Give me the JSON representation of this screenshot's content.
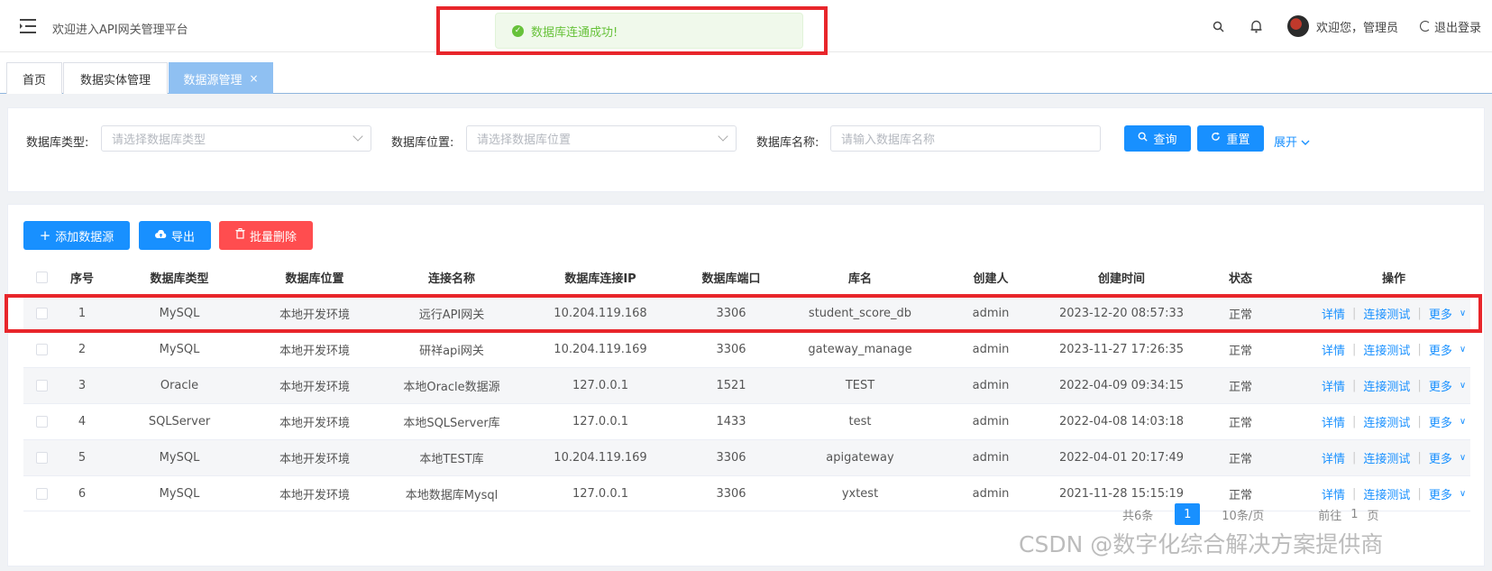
{
  "header": {
    "welcome": "欢迎进入API网关管理平台",
    "toast": "数据库连通成功!",
    "user_text": "欢迎您，管理员",
    "logout": "退出登录"
  },
  "tabs": [
    {
      "label": "首页"
    },
    {
      "label": "数据实体管理"
    },
    {
      "label": "数据源管理",
      "close": "×"
    }
  ],
  "filters": {
    "db_type_label": "数据库类型:",
    "db_type_placeholder": "请选择数据库类型",
    "db_location_label": "数据库位置:",
    "db_location_placeholder": "请选择数据库位置",
    "db_name_label": "数据库名称:",
    "db_name_placeholder": "请输入数据库名称",
    "query": "查询",
    "reset": "重置",
    "expand": "展开"
  },
  "toolbar": {
    "add": "添加数据源",
    "export": "导出",
    "batch_delete": "批量删除"
  },
  "table": {
    "headers": [
      "序号",
      "数据库类型",
      "数据库位置",
      "连接名称",
      "数据库连接IP",
      "数据库端口",
      "库名",
      "创建人",
      "创建时间",
      "状态",
      "操作"
    ],
    "rows": [
      [
        "1",
        "MySQL",
        "本地开发环境",
        "远行API网关",
        "10.204.119.168",
        "3306",
        "student_score_db",
        "admin",
        "2023-12-20 08:57:33",
        "正常"
      ],
      [
        "2",
        "MySQL",
        "本地开发环境",
        "研祥api网关",
        "10.204.119.169",
        "3306",
        "gateway_manage",
        "admin",
        "2023-11-27 17:26:35",
        "正常"
      ],
      [
        "3",
        "Oracle",
        "本地开发环境",
        "本地Oracle数据源",
        "127.0.0.1",
        "1521",
        "TEST",
        "admin",
        "2022-04-09 09:34:15",
        "正常"
      ],
      [
        "4",
        "SQLServer",
        "本地开发环境",
        "本地SQLServer库",
        "127.0.0.1",
        "1433",
        "test",
        "admin",
        "2022-04-08 14:03:18",
        "正常"
      ],
      [
        "5",
        "MySQL",
        "本地开发环境",
        "本地TEST库",
        "10.204.119.169",
        "3306",
        "apigateway",
        "admin",
        "2022-04-01 20:17:49",
        "正常"
      ],
      [
        "6",
        "MySQL",
        "本地开发环境",
        "本地数据库Mysql",
        "127.0.0.1",
        "3306",
        "yxtest",
        "admin",
        "2021-11-28 15:15:19",
        "正常"
      ]
    ],
    "ops": {
      "detail": "详情",
      "test": "连接测试",
      "more": "更多"
    }
  },
  "pager": {
    "total": "共6条",
    "page": "1",
    "per_page": "10条/页",
    "goto": "前往",
    "goto_page": "1",
    "page_unit": "页"
  },
  "watermark": "CSDN @数字化综合解决方案提供商"
}
